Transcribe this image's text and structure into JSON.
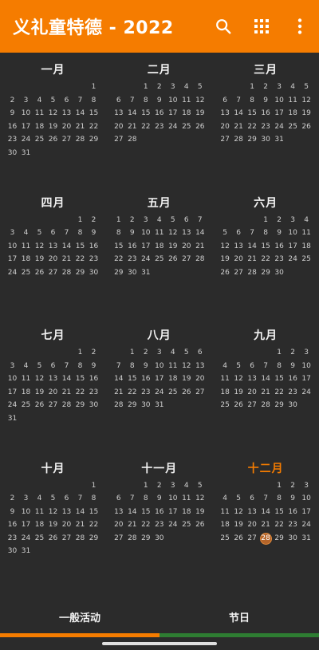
{
  "app_bar": {
    "title": "义礼童特德 - 2022",
    "icons": [
      "search-icon",
      "apps-grid-icon",
      "more-vert-icon"
    ],
    "color": "#f57c00"
  },
  "calendar": {
    "today": {
      "month_index": 11,
      "day": 28
    },
    "months": [
      {
        "name": "一月",
        "offset": 6,
        "days": 31
      },
      {
        "name": "二月",
        "offset": 2,
        "days": 28
      },
      {
        "name": "三月",
        "offset": 2,
        "days": 31
      },
      {
        "name": "四月",
        "offset": 5,
        "days": 30
      },
      {
        "name": "五月",
        "offset": 0,
        "days": 31
      },
      {
        "name": "六月",
        "offset": 3,
        "days": 30
      },
      {
        "name": "七月",
        "offset": 5,
        "days": 31
      },
      {
        "name": "八月",
        "offset": 1,
        "days": 31
      },
      {
        "name": "九月",
        "offset": 4,
        "days": 30
      },
      {
        "name": "十月",
        "offset": 6,
        "days": 31
      },
      {
        "name": "十一月",
        "offset": 2,
        "days": 30
      },
      {
        "name": "十二月",
        "offset": 4,
        "days": 31
      }
    ]
  },
  "tabs": {
    "general": "一般活动",
    "holidays": "节日"
  },
  "colors": {
    "accent": "#f57c00",
    "green": "#2e7d32",
    "background": "#2b2b2b"
  }
}
